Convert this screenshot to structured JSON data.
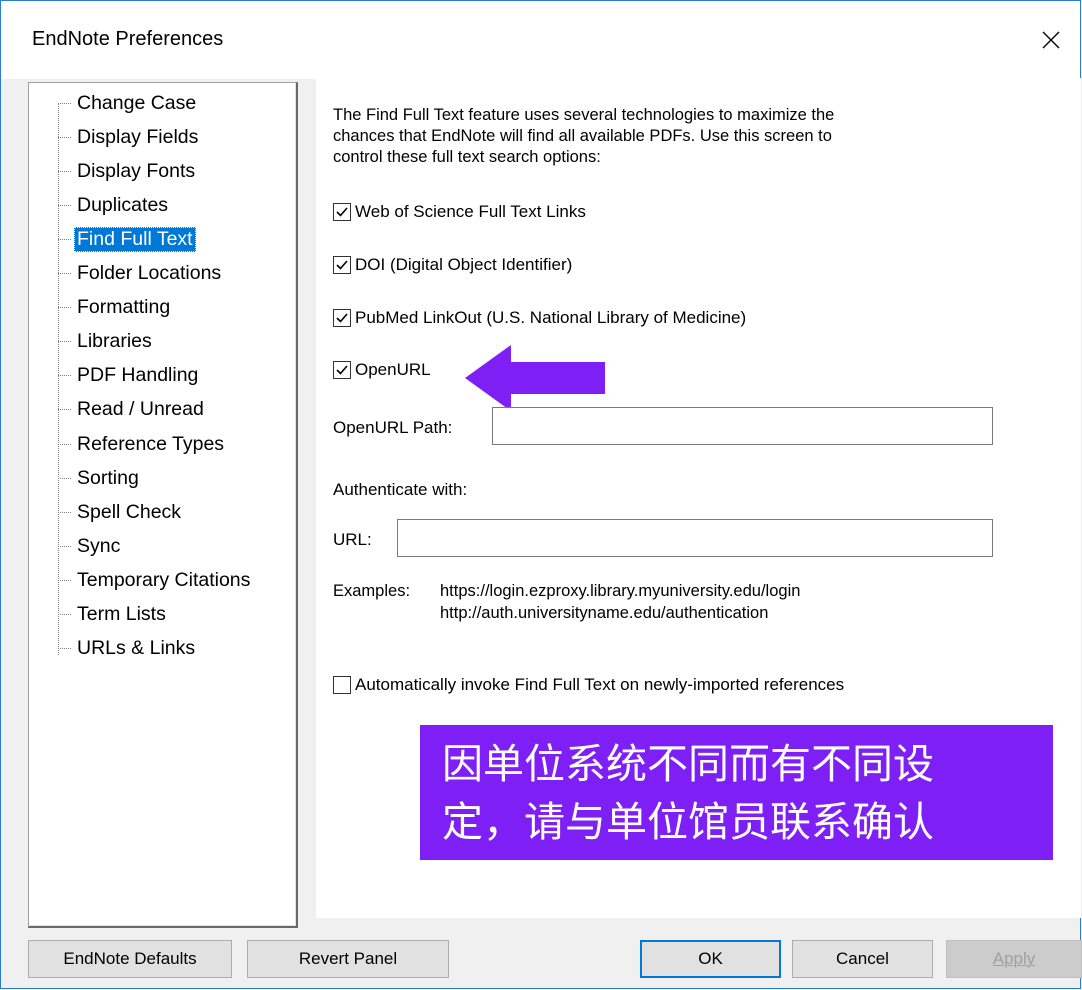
{
  "window": {
    "title": "EndNote Preferences",
    "close_glyph": "✕"
  },
  "sidebar": {
    "items": [
      {
        "label": "Change Case"
      },
      {
        "label": "Display Fields"
      },
      {
        "label": "Display Fonts"
      },
      {
        "label": "Duplicates"
      },
      {
        "label": "Find Full Text",
        "selected": true
      },
      {
        "label": "Folder Locations"
      },
      {
        "label": "Formatting"
      },
      {
        "label": "Libraries"
      },
      {
        "label": "PDF Handling"
      },
      {
        "label": "Read / Unread"
      },
      {
        "label": "Reference Types"
      },
      {
        "label": "Sorting"
      },
      {
        "label": "Spell Check"
      },
      {
        "label": "Sync"
      },
      {
        "label": "Temporary Citations"
      },
      {
        "label": "Term Lists"
      },
      {
        "label": "URLs & Links"
      }
    ]
  },
  "panel": {
    "intro_line1": "The Find Full Text feature uses several technologies to maximize the",
    "intro_line2": "chances that EndNote will find all available PDFs. Use this screen to",
    "intro_line3": "control these full text search options:",
    "options": {
      "wos": {
        "label": "Web of Science Full Text Links",
        "checked": true
      },
      "doi": {
        "label": "DOI (Digital Object Identifier)",
        "checked": true
      },
      "pubmed": {
        "label": "PubMed LinkOut (U.S. National Library of Medicine)",
        "checked": true
      },
      "openurl": {
        "label": "OpenURL",
        "checked": true
      },
      "auto": {
        "label": "Automatically invoke Find Full Text on newly-imported references",
        "checked": false
      }
    },
    "openurl_path_label": "OpenURL Path:",
    "openurl_path_value": "",
    "authenticate_label": "Authenticate with:",
    "url_label": "URL:",
    "url_value": "",
    "examples_label": "Examples:",
    "example1": "https://login.ezproxy.library.myuniversity.edu/login",
    "example2": "http://auth.universityname.edu/authentication"
  },
  "annotation": {
    "note_line1": "因单位系统不同而有不同设",
    "note_line2": "定，请与单位馆员联系确认",
    "color": "#7d1ff5"
  },
  "buttons": {
    "defaults": "EndNote Defaults",
    "revert": "Revert Panel",
    "ok": "OK",
    "cancel": "Cancel",
    "apply": "Apply"
  },
  "colors": {
    "selection": "#0078d7",
    "window_border": "#2b7cd3"
  }
}
